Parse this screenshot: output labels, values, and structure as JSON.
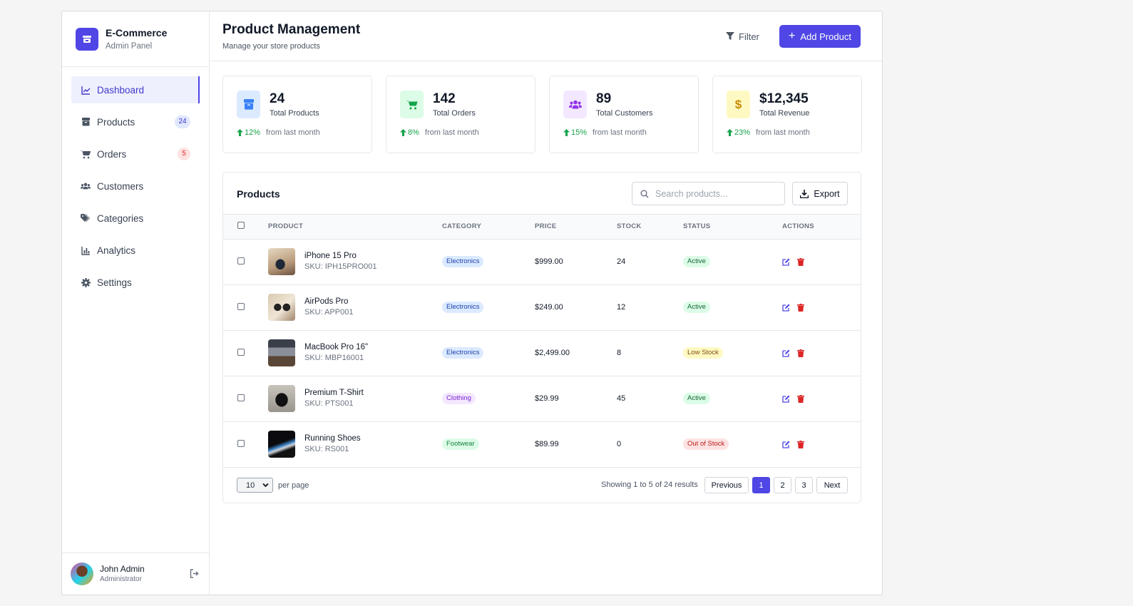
{
  "brand": {
    "title": "E-Commerce",
    "subtitle": "Admin Panel"
  },
  "nav": [
    {
      "label": "Dashboard",
      "icon": "chart-line-icon",
      "active": true
    },
    {
      "label": "Products",
      "icon": "box-icon",
      "badge": "24"
    },
    {
      "label": "Orders",
      "icon": "cart-icon",
      "badge": "5"
    },
    {
      "label": "Customers",
      "icon": "users-icon"
    },
    {
      "label": "Categories",
      "icon": "tags-icon"
    },
    {
      "label": "Analytics",
      "icon": "chart-bar-icon"
    },
    {
      "label": "Settings",
      "icon": "gear-icon"
    }
  ],
  "user": {
    "name": "John Admin",
    "role": "Administrator"
  },
  "header": {
    "title": "Product Management",
    "subtitle": "Manage your store products",
    "filter_label": "Filter",
    "add_label": "Add Product"
  },
  "stats": [
    {
      "value": "24",
      "label": "Total Products",
      "trend": "12%",
      "trend_note": "from last month",
      "icon": "box-icon",
      "color": "#3b82f6",
      "bg": "#dbeafe"
    },
    {
      "value": "142",
      "label": "Total Orders",
      "trend": "8%",
      "trend_note": "from last month",
      "icon": "cart-icon",
      "color": "#16a34a",
      "bg": "#dcfce7"
    },
    {
      "value": "89",
      "label": "Total Customers",
      "trend": "15%",
      "trend_note": "from last month",
      "icon": "users-icon",
      "color": "#9333ea",
      "bg": "#f3e8ff"
    },
    {
      "value": "$12,345",
      "label": "Total Revenue",
      "trend": "23%",
      "trend_note": "from last month",
      "icon": "dollar-icon",
      "color": "#ca8a04",
      "bg": "#fef9c3"
    }
  ],
  "products_card": {
    "title": "Products",
    "search_placeholder": "Search products...",
    "export_label": "Export",
    "columns": [
      "PRODUCT",
      "CATEGORY",
      "PRICE",
      "STOCK",
      "STATUS",
      "ACTIONS"
    ],
    "rows": [
      {
        "name": "iPhone 15 Pro",
        "sku": "SKU: IPH15PRO001",
        "category": "Electronics",
        "price": "$999.00",
        "stock": "24",
        "status": "Active"
      },
      {
        "name": "AirPods Pro",
        "sku": "SKU: APP001",
        "category": "Electronics",
        "price": "$249.00",
        "stock": "12",
        "status": "Active"
      },
      {
        "name": "MacBook Pro 16\"",
        "sku": "SKU: MBP16001",
        "category": "Electronics",
        "price": "$2,499.00",
        "stock": "8",
        "status": "Low Stock"
      },
      {
        "name": "Premium T-Shirt",
        "sku": "SKU: PTS001",
        "category": "Clothing",
        "price": "$29.99",
        "stock": "45",
        "status": "Active"
      },
      {
        "name": "Running Shoes",
        "sku": "SKU: RS001",
        "category": "Footwear",
        "price": "$89.99",
        "stock": "0",
        "status": "Out of Stock"
      }
    ],
    "per_page_value": "10",
    "per_page_label": "per page",
    "showing": "Showing 1 to 5 of 24 results",
    "pagination": [
      "Previous",
      "1",
      "2",
      "3",
      "Next"
    ],
    "active_page": "1"
  },
  "colors": {
    "accent": "#4f46e5"
  }
}
